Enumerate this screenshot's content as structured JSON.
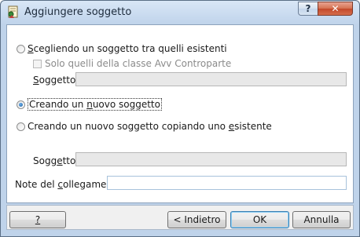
{
  "window": {
    "title": "Aggiungere soggetto",
    "help_button": "?",
    "close_button": "✕"
  },
  "options": {
    "existing": {
      "label_accel": "S",
      "label_rest": "cegliendo un soggetto tra quelli esistenti",
      "checked": false
    },
    "only_class": {
      "label": "Solo quelli della classe Avv Controparte",
      "checked": false
    },
    "soggetto1": {
      "label_pre": "",
      "label_accel": "S",
      "label_rest": "oggetto:",
      "value": ""
    },
    "new": {
      "label_pre": "Creando un ",
      "label_accel": "n",
      "label_rest": "uovo soggetto",
      "checked": true
    },
    "copy": {
      "label_pre": "Creando un nuovo soggetto copiando uno ",
      "label_accel": "e",
      "label_rest": "sistente",
      "checked": false
    },
    "soggetto2": {
      "label_pre": "Sogg",
      "label_accel": "e",
      "label_rest": "tto:",
      "value": ""
    },
    "note": {
      "label_pre": "Note del ",
      "label_accel": "c",
      "label_rest": "ollegamento:",
      "value": ""
    }
  },
  "buttons": {
    "help": "?",
    "back": "< Indietro",
    "ok": "OK",
    "cancel": "Annulla"
  }
}
